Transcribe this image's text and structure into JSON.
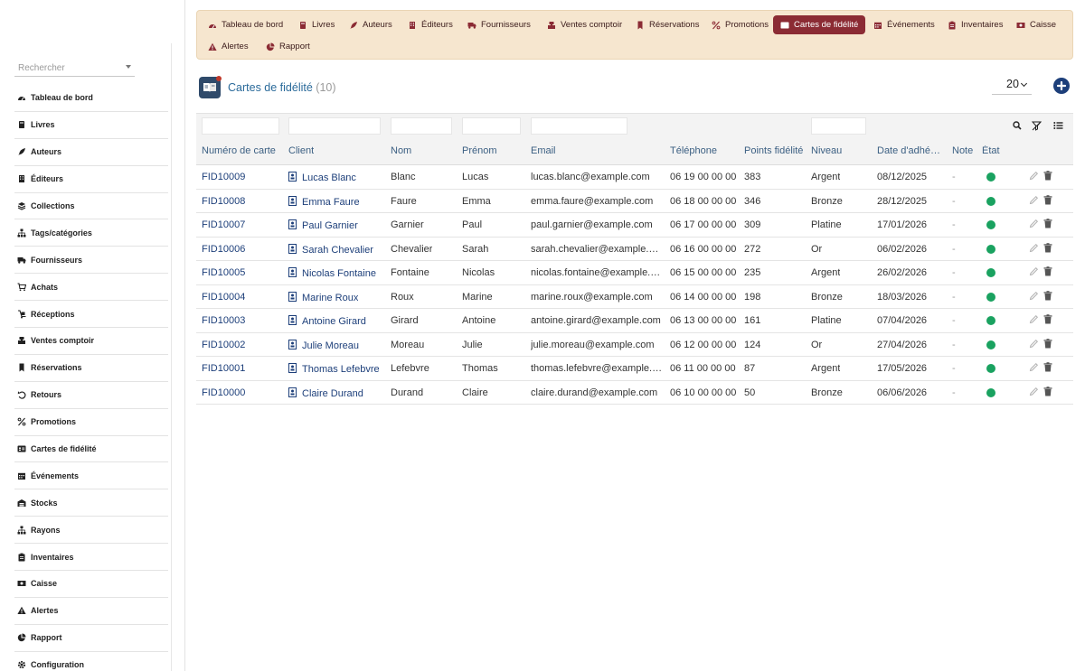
{
  "sidebar": {
    "search_placeholder": "Rechercher",
    "items": [
      {
        "label": "Tableau de bord",
        "icon": "dashboard-icon"
      },
      {
        "label": "Livres",
        "icon": "book-icon"
      },
      {
        "label": "Auteurs",
        "icon": "feather-icon"
      },
      {
        "label": "Éditeurs",
        "icon": "building-icon"
      },
      {
        "label": "Collections",
        "icon": "layers-icon"
      },
      {
        "label": "Tags/catégories",
        "icon": "sitemap-icon"
      },
      {
        "label": "Fournisseurs",
        "icon": "truck-icon"
      },
      {
        "label": "Achats",
        "icon": "cart-icon"
      },
      {
        "label": "Réceptions",
        "icon": "dolly-icon"
      },
      {
        "label": "Ventes comptoir",
        "icon": "register-icon"
      },
      {
        "label": "Réservations",
        "icon": "bookmark-icon"
      },
      {
        "label": "Retours",
        "icon": "undo-icon"
      },
      {
        "label": "Promotions",
        "icon": "percent-icon"
      },
      {
        "label": "Cartes de fidélité",
        "icon": "id-card-icon"
      },
      {
        "label": "Événements",
        "icon": "calendar-icon"
      },
      {
        "label": "Stocks",
        "icon": "warehouse-icon"
      },
      {
        "label": "Rayons",
        "icon": "sitemap-icon"
      },
      {
        "label": "Inventaires",
        "icon": "clipboard-icon"
      },
      {
        "label": "Caisse",
        "icon": "cash-icon"
      },
      {
        "label": "Alertes",
        "icon": "warning-icon"
      },
      {
        "label": "Rapport",
        "icon": "pie-chart-icon"
      },
      {
        "label": "Configuration",
        "icon": "gear-icon"
      }
    ]
  },
  "topnav": {
    "items": [
      {
        "label": "Tableau de bord",
        "icon": "dashboard-icon"
      },
      {
        "label": "Livres",
        "icon": "book-icon"
      },
      {
        "label": "Auteurs",
        "icon": "feather-icon"
      },
      {
        "label": "Éditeurs",
        "icon": "building-icon"
      },
      {
        "label": "Fournisseurs",
        "icon": "truck-icon"
      },
      {
        "label": "Ventes comptoir",
        "icon": "register-icon"
      },
      {
        "label": "Réservations",
        "icon": "bookmark-icon"
      },
      {
        "label": "Promotions",
        "icon": "percent-icon"
      },
      {
        "label": "Cartes de fidélité",
        "icon": "id-card-icon",
        "active": true
      },
      {
        "label": "Événements",
        "icon": "calendar-icon"
      },
      {
        "label": "Inventaires",
        "icon": "clipboard-icon"
      },
      {
        "label": "Caisse",
        "icon": "cash-icon"
      },
      {
        "label": "Alertes",
        "icon": "warning-icon"
      },
      {
        "label": "Rapport",
        "icon": "pie-chart-icon"
      }
    ]
  },
  "page": {
    "title": "Cartes de fidélité",
    "count": "(10)",
    "per_page": "20"
  },
  "colors": {
    "nav_bg": "#f6e6cf",
    "nav_active": "#8b2b34",
    "icon_accent": "#8b2b34",
    "link": "#1d3f7a",
    "header_text": "#3b5f82",
    "status_active": "#1aa260"
  },
  "table": {
    "columns": [
      "Numéro de carte",
      "Client",
      "Nom",
      "Prénom",
      "Email",
      "Téléphone",
      "Points fidélité",
      "Niveau",
      "Date d'adhé…",
      "Note",
      "État"
    ],
    "rows": [
      {
        "card": "FID10009",
        "client": "Lucas Blanc",
        "nom": "Blanc",
        "prenom": "Lucas",
        "email": "lucas.blanc@example.com",
        "tel": "06 19 00 00 00",
        "points": "383",
        "niveau": "Argent",
        "date": "08/12/2025",
        "note": "-"
      },
      {
        "card": "FID10008",
        "client": "Emma Faure",
        "nom": "Faure",
        "prenom": "Emma",
        "email": "emma.faure@example.com",
        "tel": "06 18 00 00 00",
        "points": "346",
        "niveau": "Bronze",
        "date": "28/12/2025",
        "note": "-"
      },
      {
        "card": "FID10007",
        "client": "Paul Garnier",
        "nom": "Garnier",
        "prenom": "Paul",
        "email": "paul.garnier@example.com",
        "tel": "06 17 00 00 00",
        "points": "309",
        "niveau": "Platine",
        "date": "17/01/2026",
        "note": "-"
      },
      {
        "card": "FID10006",
        "client": "Sarah Chevalier",
        "nom": "Chevalier",
        "prenom": "Sarah",
        "email": "sarah.chevalier@example.c…",
        "tel": "06 16 00 00 00",
        "points": "272",
        "niveau": "Or",
        "date": "06/02/2026",
        "note": "-"
      },
      {
        "card": "FID10005",
        "client": "Nicolas Fontaine",
        "nom": "Fontaine",
        "prenom": "Nicolas",
        "email": "nicolas.fontaine@example.c…",
        "tel": "06 15 00 00 00",
        "points": "235",
        "niveau": "Argent",
        "date": "26/02/2026",
        "note": "-"
      },
      {
        "card": "FID10004",
        "client": "Marine Roux",
        "nom": "Roux",
        "prenom": "Marine",
        "email": "marine.roux@example.com",
        "tel": "06 14 00 00 00",
        "points": "198",
        "niveau": "Bronze",
        "date": "18/03/2026",
        "note": "-"
      },
      {
        "card": "FID10003",
        "client": "Antoine Girard",
        "nom": "Girard",
        "prenom": "Antoine",
        "email": "antoine.girard@example.com",
        "tel": "06 13 00 00 00",
        "points": "161",
        "niveau": "Platine",
        "date": "07/04/2026",
        "note": "-"
      },
      {
        "card": "FID10002",
        "client": "Julie Moreau",
        "nom": "Moreau",
        "prenom": "Julie",
        "email": "julie.moreau@example.com",
        "tel": "06 12 00 00 00",
        "points": "124",
        "niveau": "Or",
        "date": "27/04/2026",
        "note": "-"
      },
      {
        "card": "FID10001",
        "client": "Thomas Lefebvre",
        "nom": "Lefebvre",
        "prenom": "Thomas",
        "email": "thomas.lefebvre@example.…",
        "tel": "06 11 00 00 00",
        "points": "87",
        "niveau": "Argent",
        "date": "17/05/2026",
        "note": "-"
      },
      {
        "card": "FID10000",
        "client": "Claire Durand",
        "nom": "Durand",
        "prenom": "Claire",
        "email": "claire.durand@example.com",
        "tel": "06 10 00 00 00",
        "points": "50",
        "niveau": "Bronze",
        "date": "06/06/2026",
        "note": "-"
      }
    ]
  }
}
